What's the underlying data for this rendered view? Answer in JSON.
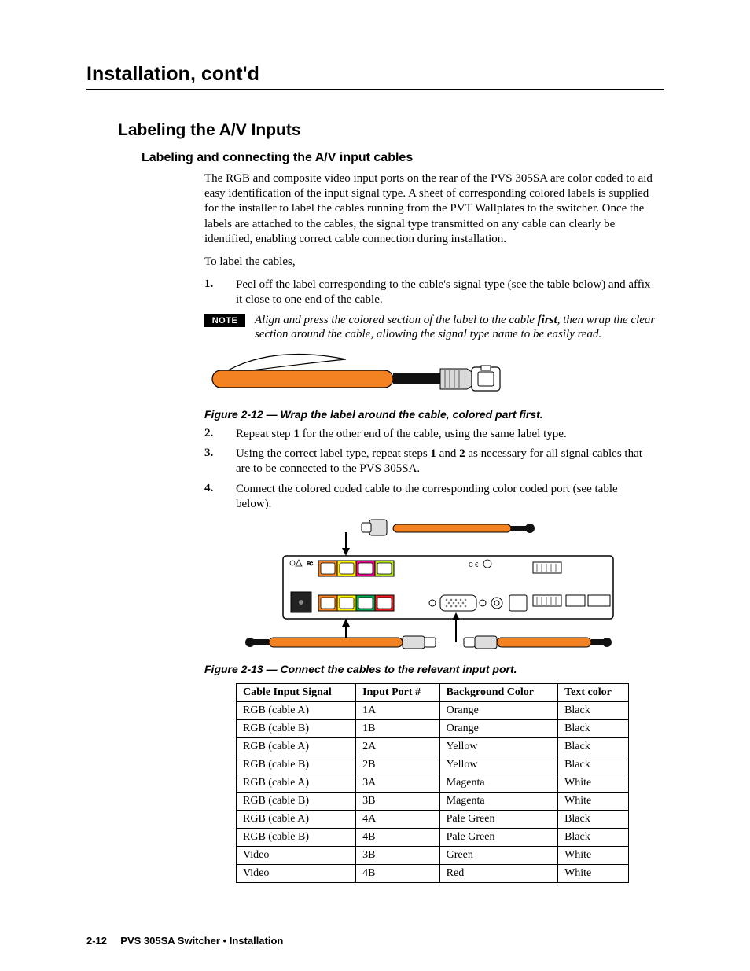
{
  "running_head": "Installation, cont'd",
  "h1": "Labeling the A/V Inputs",
  "h2": "Labeling and connecting the A/V input cables",
  "intro": "The RGB and composite video input ports on the rear of the PVS 305SA are color coded to aid easy identification of the input signal type.  A sheet of corresponding colored labels is supplied for the installer to label the cables running from the PVT Wallplates to the switcher.  Once the labels are attached to the cables, the signal type transmitted on any cable can clearly be identified, enabling correct cable connection during installation.",
  "lead_in": "To label the cables,",
  "step1_num": "1.",
  "step1": "Peel off the label corresponding to the cable's signal type (see the table below) and affix it close to one end of the cable.",
  "note_label": "NOTE",
  "note_pre": "Align and press the colored section of the label to the cable ",
  "note_bold": "first",
  "note_post": ", then wrap the clear section around the cable, allowing the signal type name to be easily read.",
  "fig12": "Figure 2-12 — Wrap the label around the cable, colored part first.",
  "step2_num": "2.",
  "step2_pre": "Repeat step ",
  "step2_b1": "1",
  "step2_post": " for the other end of the cable, using the same label type.",
  "step3_num": "3.",
  "step3_pre": "Using the correct label type, repeat steps ",
  "step3_b1": "1",
  "step3_mid": " and ",
  "step3_b2": "2",
  "step3_post": " as necessary for all signal cables that are to be connected to the PVS 305SA.",
  "step4_num": "4.",
  "step4": "Connect the colored coded cable to the corresponding color coded port (see table below).",
  "fig13": "Figure 2-13 — Connect the cables to the relevant input port.",
  "table": {
    "headers": [
      "Cable Input Signal",
      "Input Port #",
      "Background Color",
      "Text color"
    ],
    "rows": [
      [
        "RGB (cable A)",
        "1A",
        "Orange",
        "Black"
      ],
      [
        "RGB (cable B)",
        "1B",
        "Orange",
        "Black"
      ],
      [
        "RGB (cable A)",
        "2A",
        "Yellow",
        "Black"
      ],
      [
        "RGB (cable B)",
        "2B",
        "Yellow",
        "Black"
      ],
      [
        "RGB (cable A)",
        "3A",
        "Magenta",
        "White"
      ],
      [
        "RGB (cable B)",
        "3B",
        "Magenta",
        "White"
      ],
      [
        "RGB (cable A)",
        "4A",
        "Pale Green",
        "Black"
      ],
      [
        "RGB (cable B)",
        "4B",
        "Pale Green",
        "Black"
      ],
      [
        "Video",
        "3B",
        "Green",
        "White"
      ],
      [
        "Video",
        "4B",
        "Red",
        "White"
      ]
    ]
  },
  "footer_page": "2-12",
  "footer_text": "PVS 305SA Switcher • Installation"
}
